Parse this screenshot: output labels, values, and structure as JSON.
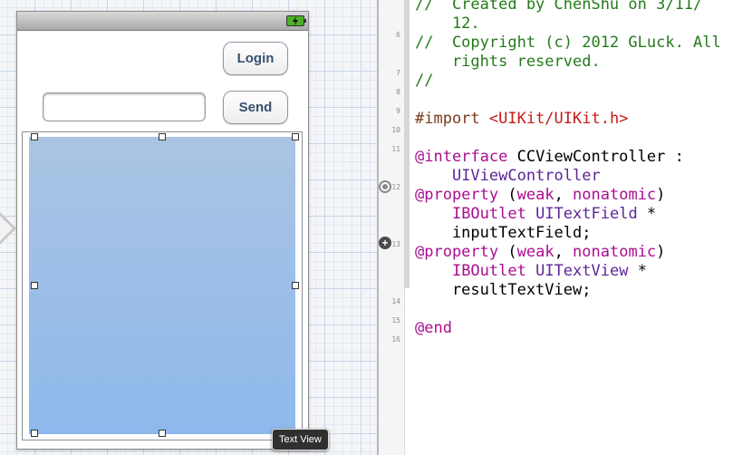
{
  "storyboard": {
    "login_button": "Login",
    "send_button": "Send",
    "input_field": {
      "value": "",
      "placeholder": ""
    },
    "text_view_tooltip": "Text View"
  },
  "editor": {
    "line_numbers": [
      "6",
      "7",
      "8",
      "9",
      "10",
      "11",
      "12",
      "13",
      "14",
      "15",
      "16"
    ],
    "lines": [
      {
        "tokens": [
          {
            "text": "//  Created by ChenShu on 3/11/",
            "kind": "comment"
          }
        ]
      },
      {
        "tokens": [
          {
            "text": "    12.",
            "kind": "comment"
          }
        ]
      },
      {
        "tokens": [
          {
            "text": "//  Copyright (c) 2012 GLuck. All",
            "kind": "comment"
          }
        ]
      },
      {
        "tokens": [
          {
            "text": "    rights reserved.",
            "kind": "comment"
          }
        ]
      },
      {
        "tokens": [
          {
            "text": "//",
            "kind": "comment"
          }
        ]
      },
      {
        "tokens": []
      },
      {
        "tokens": [
          {
            "text": "#import ",
            "kind": "pre"
          },
          {
            "text": "<UIKit/UIKit.h>",
            "kind": "str"
          }
        ]
      },
      {
        "tokens": []
      },
      {
        "tokens": [
          {
            "text": "@interface",
            "kind": "kw"
          },
          {
            "text": " CCViewController :",
            "kind": "plain"
          }
        ]
      },
      {
        "tokens": [
          {
            "text": "    ",
            "kind": "plain"
          },
          {
            "text": "UIViewController",
            "kind": "type"
          }
        ]
      },
      {
        "tokens": [
          {
            "text": "@property",
            "kind": "kw"
          },
          {
            "text": " (",
            "kind": "plain"
          },
          {
            "text": "weak",
            "kind": "kw"
          },
          {
            "text": ", ",
            "kind": "plain"
          },
          {
            "text": "nonatomic",
            "kind": "kw"
          },
          {
            "text": ")",
            "kind": "plain"
          }
        ]
      },
      {
        "tokens": [
          {
            "text": "    ",
            "kind": "plain"
          },
          {
            "text": "IBOutlet",
            "kind": "kw"
          },
          {
            "text": " ",
            "kind": "plain"
          },
          {
            "text": "UITextField",
            "kind": "type"
          },
          {
            "text": " *",
            "kind": "plain"
          }
        ]
      },
      {
        "tokens": [
          {
            "text": "    inputTextField;",
            "kind": "plain"
          }
        ]
      },
      {
        "tokens": [
          {
            "text": "@property",
            "kind": "kw"
          },
          {
            "text": " (",
            "kind": "plain"
          },
          {
            "text": "weak",
            "kind": "kw"
          },
          {
            "text": ", ",
            "kind": "plain"
          },
          {
            "text": "nonatomic",
            "kind": "kw"
          },
          {
            "text": ")",
            "kind": "plain"
          }
        ]
      },
      {
        "tokens": [
          {
            "text": "    ",
            "kind": "plain"
          },
          {
            "text": "IBOutlet",
            "kind": "kw"
          },
          {
            "text": " ",
            "kind": "plain"
          },
          {
            "text": "UITextView",
            "kind": "type"
          },
          {
            "text": " *",
            "kind": "plain"
          }
        ]
      },
      {
        "tokens": [
          {
            "text": "    resultTextView;",
            "kind": "plain"
          }
        ]
      },
      {
        "tokens": []
      },
      {
        "tokens": [
          {
            "text": "@end",
            "kind": "kw"
          }
        ]
      },
      {
        "tokens": []
      }
    ]
  },
  "colors": {
    "comment": "#237b1a",
    "keyword": "#aa0d91",
    "type": "#5c2699",
    "string": "#c41a16",
    "preprocessor": "#7b3a1c"
  },
  "icons": {
    "battery": "battery-charging-icon",
    "outlet_connected": "outlet-connected-icon",
    "outlet_add": "outlet-add-icon"
  }
}
